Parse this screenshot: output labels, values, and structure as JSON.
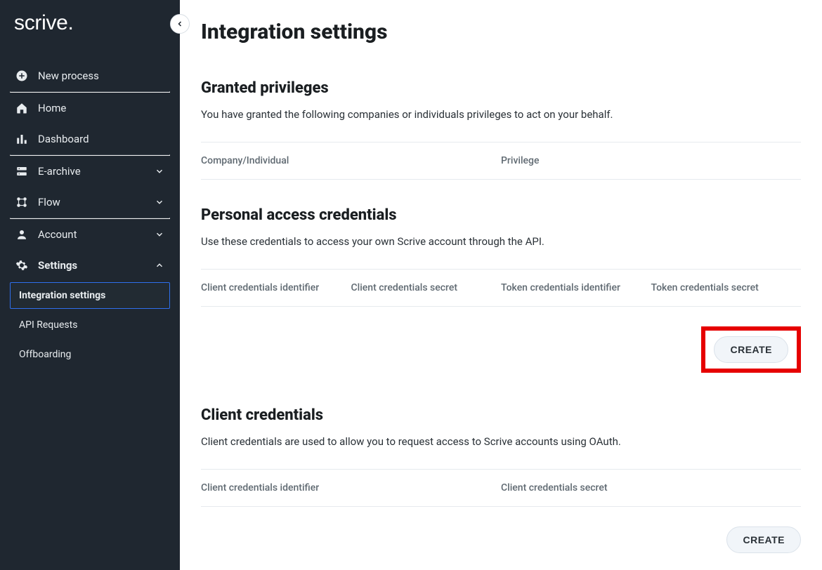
{
  "brand": "scrive.",
  "sidebar": {
    "new_process": "New process",
    "home": "Home",
    "dashboard": "Dashboard",
    "earchive": "E-archive",
    "flow": "Flow",
    "account": "Account",
    "settings": "Settings",
    "sub": {
      "integration": "Integration settings",
      "api_requests": "API Requests",
      "offboarding": "Offboarding"
    }
  },
  "page": {
    "title": "Integration settings"
  },
  "granted": {
    "title": "Granted privileges",
    "desc": "You have granted the following companies or individuals privileges to act on your behalf.",
    "cols": {
      "company": "Company/Individual",
      "privilege": "Privilege"
    }
  },
  "personal": {
    "title": "Personal access credentials",
    "desc": "Use these credentials to access your own Scrive account through the API.",
    "cols": {
      "cci": "Client credentials identifier",
      "ccs": "Client credentials secret",
      "tci": "Token credentials identifier",
      "tcs": "Token credentials secret"
    },
    "create": "CREATE"
  },
  "client": {
    "title": "Client credentials",
    "desc": "Client credentials are used to allow you to request access to Scrive accounts using OAuth.",
    "cols": {
      "cci": "Client credentials identifier",
      "ccs": "Client credentials secret"
    },
    "create": "CREATE"
  }
}
